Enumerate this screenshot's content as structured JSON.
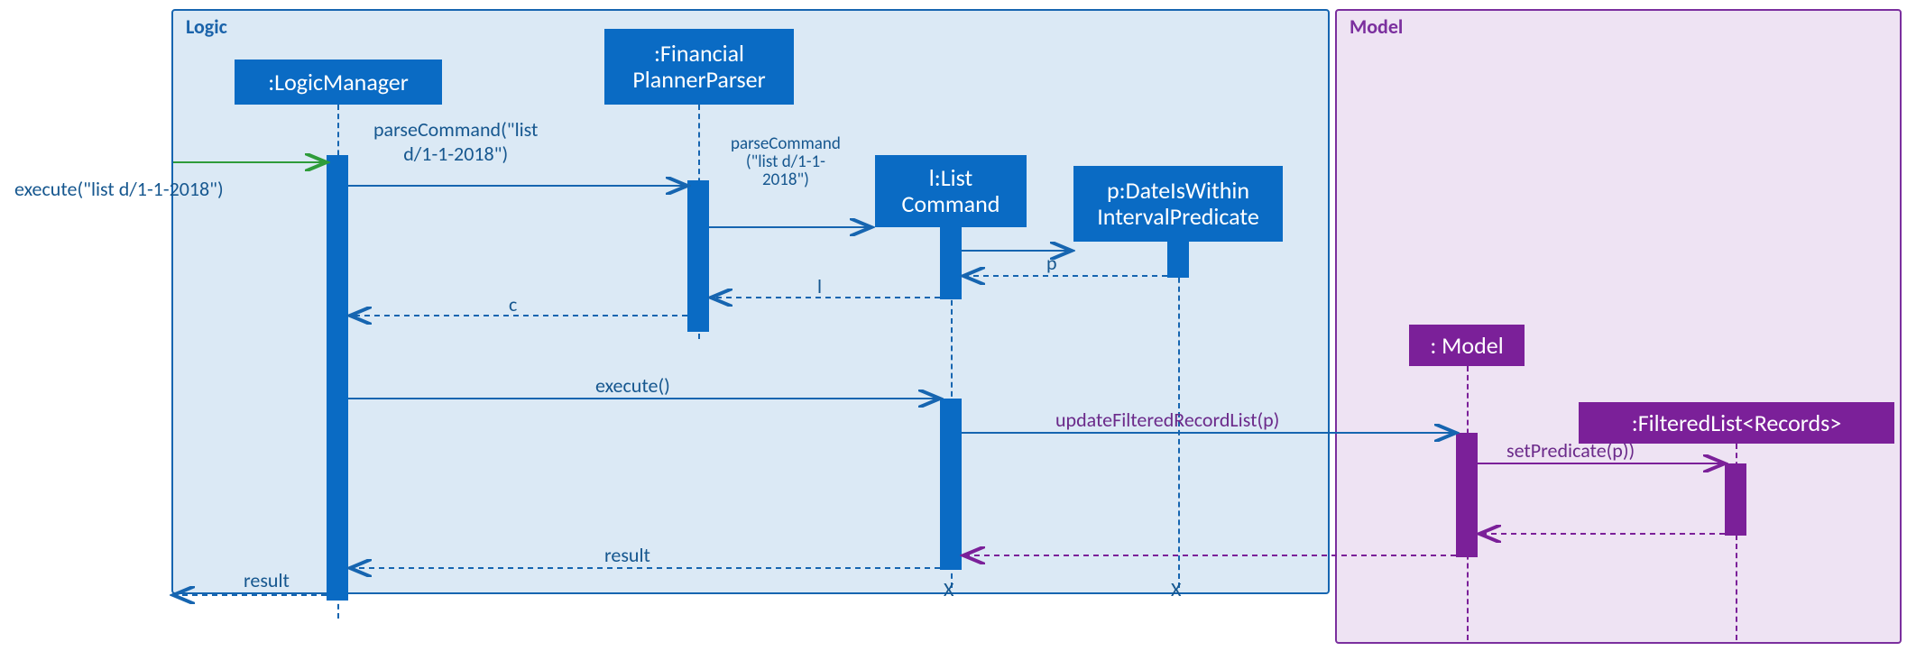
{
  "packages": {
    "logic": "Logic",
    "model": "Model"
  },
  "lifelines": {
    "logicManager": ":LogicManager",
    "financialPlannerParser": ":Financial\nPlannerParser",
    "listCommand": "l:List\nCommand",
    "datePredicate": "p:DateIsWithin\nIntervalPredicate",
    "modelObj": ": Model",
    "filteredList": ":FilteredList<Records>"
  },
  "messages": {
    "entryExecute": "execute(\"list d/1-1-2018\")",
    "parseCommand1": "parseCommand(\"list\nd/1-1-2018\")",
    "parseCommand2": "parseCommand\n(\"list d/1-1-\n2018\")",
    "retP": "p",
    "retL": "l",
    "retC": "c",
    "execute": "execute()",
    "updateFiltered": "updateFilteredRecordList(p)",
    "setPredicate": "setPredicate(p))",
    "result1": "result",
    "result2": "result"
  },
  "destroy": "X"
}
